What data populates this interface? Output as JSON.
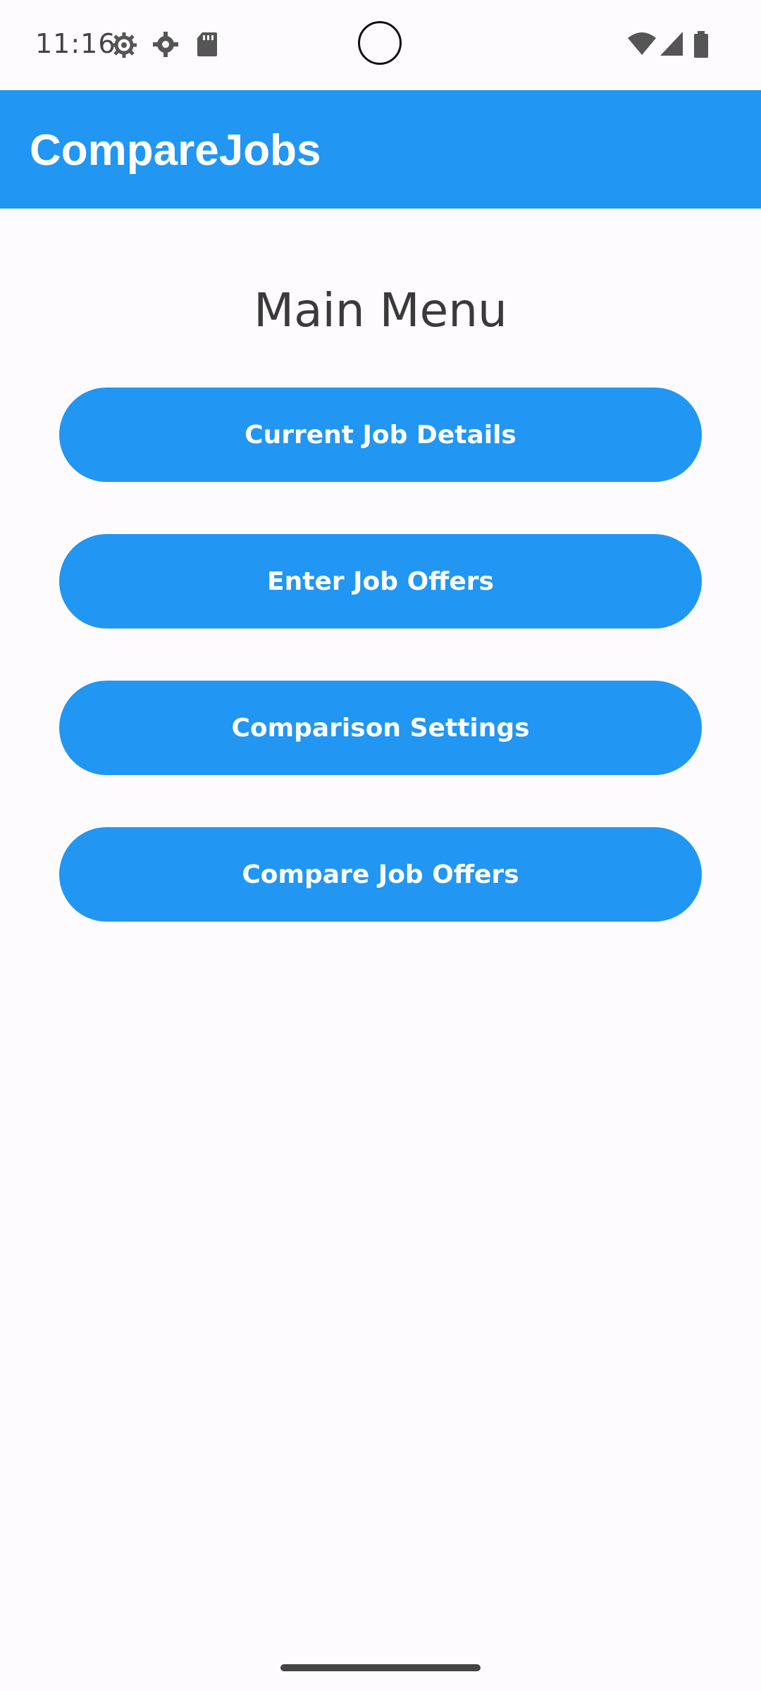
{
  "status_bar": {
    "time": "11:16",
    "icons": [
      "gear-outline-icon",
      "settings-icon",
      "sd-card-icon",
      "wifi-icon",
      "signal-icon",
      "battery-icon"
    ]
  },
  "app_bar": {
    "title": "CompareJobs",
    "color": "#2196f3"
  },
  "main": {
    "title": "Main Menu",
    "buttons": [
      {
        "label": "Current Job Details"
      },
      {
        "label": "Enter Job Offers"
      },
      {
        "label": "Comparison Settings"
      },
      {
        "label": "Compare Job Offers"
      }
    ]
  }
}
